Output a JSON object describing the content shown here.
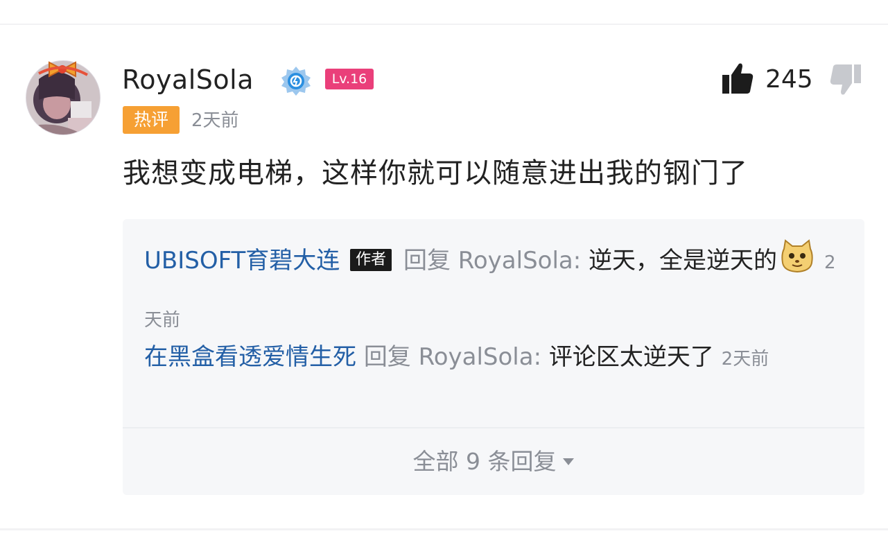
{
  "comment": {
    "username": "RoyalSola",
    "level": "Lv.16",
    "hot_label": "热评",
    "time": "2天前",
    "likes": "245",
    "text": "我想变成电梯，这样你就可以随意进出我的钢门了",
    "verified_icon": "verified-badge-icon",
    "like_icon": "thumbs-up-icon",
    "dislike_icon": "thumbs-down-icon"
  },
  "replies": [
    {
      "author": "UBISOFT育碧大连",
      "author_tag": "作者",
      "reply_word": "回复",
      "target": "RoyalSola:",
      "text": "逆天，全是逆天的",
      "emoji": "cat-face-emoji",
      "time": "2天前"
    },
    {
      "author": "在黑盒看透爱情生死",
      "reply_word": "回复",
      "target": "RoyalSola:",
      "text": "评论区太逆天了",
      "time": "2天前"
    }
  ],
  "more_replies": "全部 9 条回复",
  "colors": {
    "level_badge": "#ea3f7a",
    "hot_badge": "#f6a034",
    "reply_name": "#235fa6",
    "muted_text": "#8a8e96"
  }
}
